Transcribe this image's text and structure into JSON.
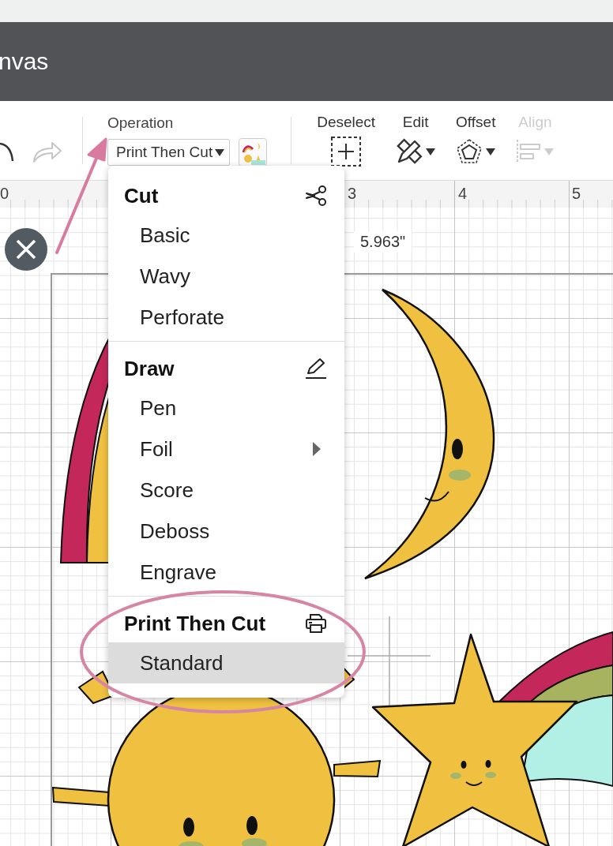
{
  "header": {
    "title": "nvas"
  },
  "toolbar": {
    "operation": {
      "label": "Operation",
      "value": "Print Then Cut"
    },
    "tools": [
      {
        "kind": "deselect",
        "label": "Deselect",
        "disabled": false,
        "has_caret": false
      },
      {
        "kind": "edit",
        "label": "Edit",
        "disabled": false,
        "has_caret": true
      },
      {
        "kind": "offset",
        "label": "Offset",
        "disabled": false,
        "has_caret": true
      },
      {
        "kind": "align",
        "label": "Align",
        "disabled": true,
        "has_caret": true
      }
    ]
  },
  "ruler": {
    "marks": [
      "0",
      "3",
      "4",
      "5"
    ]
  },
  "dimension": "5.963\"",
  "menu": {
    "sections": [
      {
        "kind": "cut",
        "title": "Cut",
        "items": [
          {
            "label": "Basic",
            "selected": false,
            "has_submenu": false
          },
          {
            "label": "Wavy",
            "selected": false,
            "has_submenu": false
          },
          {
            "label": "Perforate",
            "selected": false,
            "has_submenu": false
          }
        ]
      },
      {
        "kind": "draw",
        "title": "Draw",
        "items": [
          {
            "label": "Pen",
            "selected": false,
            "has_submenu": false
          },
          {
            "label": "Foil",
            "selected": false,
            "has_submenu": true
          },
          {
            "label": "Score",
            "selected": false,
            "has_submenu": false
          },
          {
            "label": "Deboss",
            "selected": false,
            "has_submenu": false
          },
          {
            "label": "Engrave",
            "selected": false,
            "has_submenu": false
          }
        ]
      },
      {
        "kind": "print",
        "title": "Print Then Cut",
        "items": [
          {
            "label": "Standard",
            "selected": true,
            "has_submenu": false
          }
        ]
      }
    ]
  }
}
